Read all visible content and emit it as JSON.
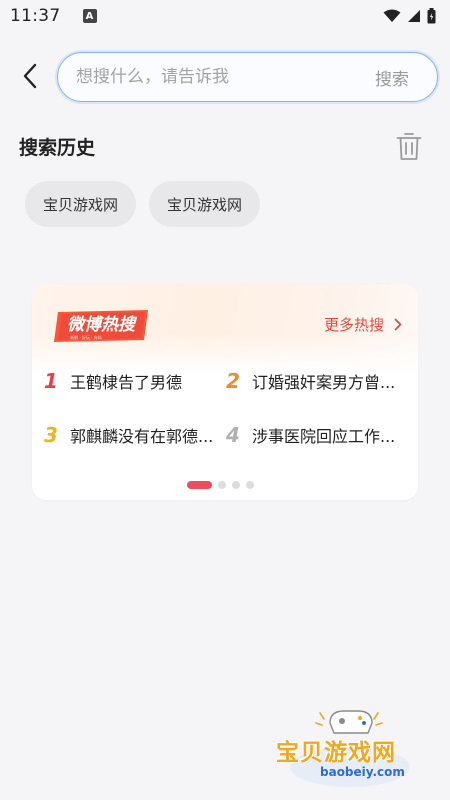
{
  "status_bar": {
    "time": "11:37",
    "notification_letter": "A",
    "icons": [
      "wifi-icon",
      "signal-icon",
      "battery-icon"
    ]
  },
  "search": {
    "placeholder": "想搜什么，请告诉我",
    "submit_label": "搜索"
  },
  "history": {
    "title": "搜索历史",
    "chips": [
      "宝贝游戏网",
      "宝贝游戏网"
    ]
  },
  "hot": {
    "logo_text": "微博热搜",
    "logo_subtext": "新鲜 · 好玩 · 有料",
    "more_label": "更多热搜",
    "items": [
      {
        "rank": "1",
        "text": "王鹤棣告了男德"
      },
      {
        "rank": "2",
        "text": "订婚强奸案男方曾..."
      },
      {
        "rank": "3",
        "text": "郭麒麟没有在郭德..."
      },
      {
        "rank": "4",
        "text": "涉事医院回应工作..."
      }
    ],
    "pages": 4,
    "active_page": 1
  },
  "watermark": {
    "title": "宝贝游戏网",
    "domain": "baobeiy.com"
  },
  "colors": {
    "accent_red": "#e84a3c",
    "rank_1": "#e83f3f",
    "rank_2": "#f08a2e",
    "rank_3": "#f3b21b",
    "rank_4": "#b0b0b0",
    "search_border": "#8ab4f0"
  }
}
